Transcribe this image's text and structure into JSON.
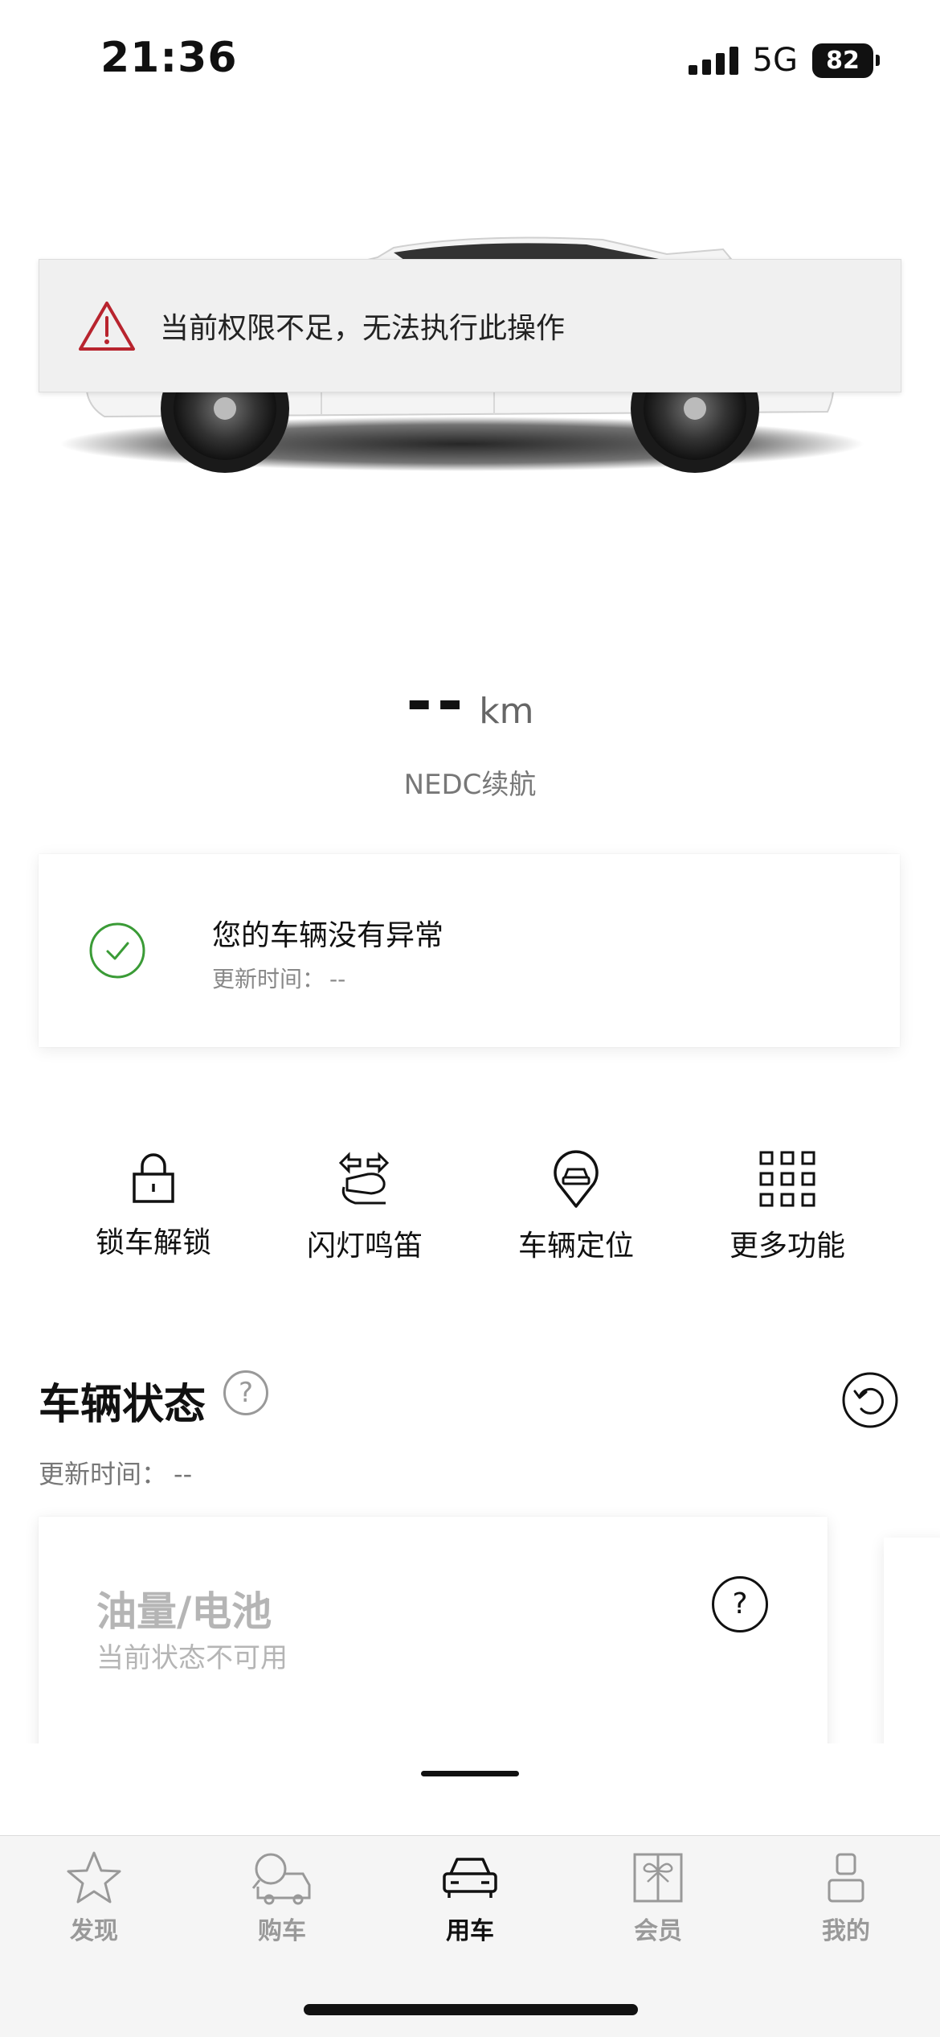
{
  "status_bar": {
    "time": "21:36",
    "network": "5G",
    "battery": "82"
  },
  "toast": {
    "message": "当前权限不足，无法执行此操作"
  },
  "range": {
    "value": "--",
    "unit": "km",
    "label": "NEDC续航"
  },
  "health": {
    "title": "您的车辆没有异常",
    "update_label": "更新时间：",
    "update_value": "--"
  },
  "actions": [
    {
      "label": "锁车解锁",
      "icon": "lock-icon"
    },
    {
      "label": "闪灯鸣笛",
      "icon": "horn-light-icon"
    },
    {
      "label": "车辆定位",
      "icon": "car-location-icon"
    },
    {
      "label": "更多功能",
      "icon": "grid-icon"
    }
  ],
  "vehicle_status": {
    "title": "车辆状态",
    "help": "?",
    "update_label": "更新时间：",
    "update_value": "--",
    "card": {
      "title": "油量/电池",
      "subtitle": "当前状态不可用",
      "help": "?"
    }
  },
  "tabs": [
    {
      "label": "发现",
      "icon": "star-icon",
      "active": false
    },
    {
      "label": "购车",
      "icon": "car-search-icon",
      "active": false
    },
    {
      "label": "用车",
      "icon": "car-icon",
      "active": true
    },
    {
      "label": "会员",
      "icon": "gift-icon",
      "active": false
    },
    {
      "label": "我的",
      "icon": "person-icon",
      "active": false
    }
  ],
  "colors": {
    "warning": "#b8242e",
    "success": "#3a9b36",
    "text": "#111111",
    "muted": "#888888",
    "disabled": "#b5b5b5"
  }
}
